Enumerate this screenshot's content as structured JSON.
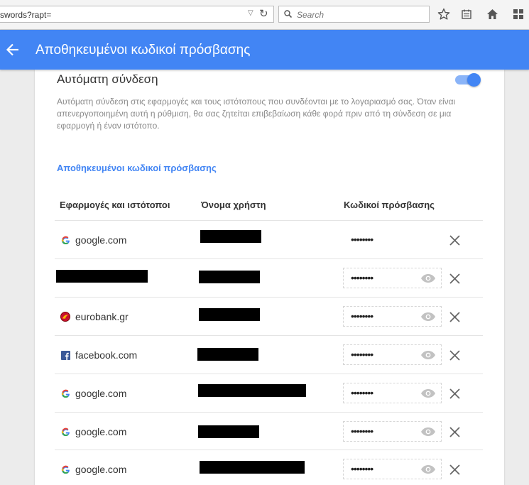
{
  "browser": {
    "url": "swords?rapt=",
    "search_placeholder": "Search"
  },
  "header": {
    "title": "Αποθηκευμένοι κωδικοί πρόσβασης"
  },
  "autosignin": {
    "title": "Αυτόματη σύνδεση",
    "enabled": true,
    "description": "Αυτόματη σύνδεση στις εφαρμογές και τους ιστότοπους που συνδέονται με το λογαριασμό σας. Όταν είναι απενεργοποιημένη αυτή η ρύθμιση, θα σας ζητείται επιβεβαίωση κάθε φορά πριν από τη σύνδεση σε μια εφαρμογή ή έναν ιστότοπο."
  },
  "passwords": {
    "section_title": "Αποθηκευμένοι κωδικοί πρόσβασης",
    "columns": {
      "site": "Εφαρμογές και ιστότοποι",
      "username": "Όνομα χρήστη",
      "password": "Κωδικοί πρόσβασης"
    },
    "rows": [
      {
        "site": "google.com",
        "icon": "google-icon",
        "password": "••••••••"
      },
      {
        "site": "",
        "icon": "",
        "password": "••••••••"
      },
      {
        "site": "eurobank.gr",
        "icon": "eurobank-icon",
        "password": "••••••••"
      },
      {
        "site": "facebook.com",
        "icon": "facebook-icon",
        "password": "••••••••"
      },
      {
        "site": "google.com",
        "icon": "google-icon",
        "password": "••••••••"
      },
      {
        "site": "google.com",
        "icon": "google-icon",
        "password": "••••••••"
      },
      {
        "site": "google.com",
        "icon": "google-icon",
        "password": "••••••••"
      }
    ]
  },
  "colors": {
    "accent": "#4285f4",
    "toggle_track": "#8ab4f8",
    "redaction": "#000000"
  }
}
